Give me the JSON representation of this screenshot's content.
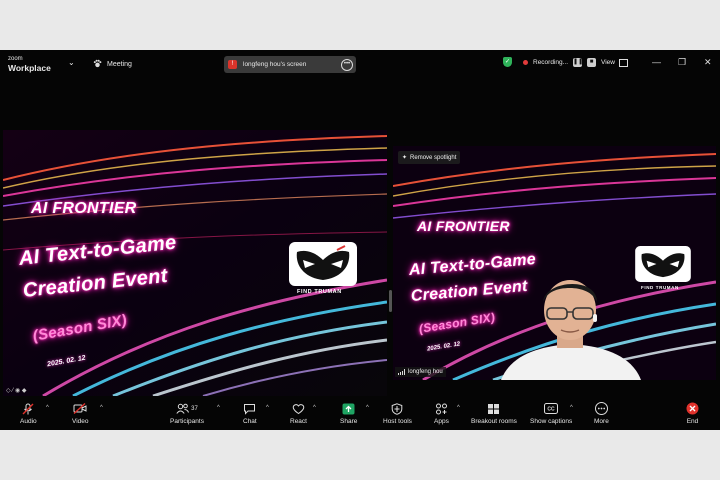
{
  "titlebar": {
    "logo_top": "zoom",
    "logo_bottom": "Workplace",
    "meeting_label": "Meeting",
    "share_label": "longfeng hou's screen",
    "recording_label": "Recording...",
    "view_label": "View"
  },
  "slide": {
    "line1": "AI FRONTIER",
    "line2": "AI Text-to-Game",
    "line3": "Creation Event",
    "line4": "(Season SIX)",
    "date": "2025. 02. 12",
    "brand": "FIND TRUMAN"
  },
  "spotlight": {
    "remove_label": "Remove spotlight",
    "participant_name": "longfeng hou"
  },
  "toolbar": {
    "audio": "Audio",
    "video": "Video",
    "participants": "Participants",
    "participants_count": "37",
    "chat": "Chat",
    "react": "React",
    "share": "Share",
    "host_tools": "Host tools",
    "apps": "Apps",
    "breakout_rooms": "Breakout rooms",
    "show_captions": "Show captions",
    "more": "More",
    "end": "End"
  },
  "colors": {
    "share_green": "#1fa463",
    "end_red": "#e0322c",
    "neon_pink": "#ff33cc",
    "bg_black": "#050505"
  }
}
